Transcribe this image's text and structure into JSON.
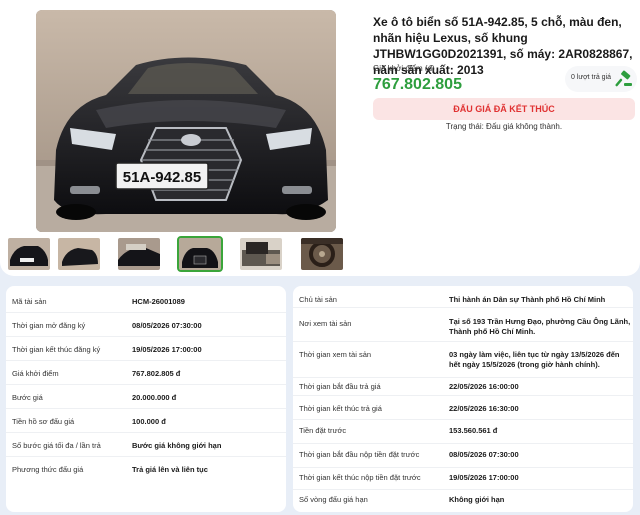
{
  "listing": {
    "title": "Xe ô tô biển số 51A-942.85, 5 chỗ, màu đen, nhãn hiệu Lexus, số khung JTHBW1GG0D2021391, số máy: 2AR0828867, năm sản xuất: 2013",
    "price_label": "Giá khởi điểm (đ)",
    "price": "767.802.805",
    "bid_count": "0 lượt trả giá",
    "status_button": "ĐẤU GIÁ ĐÃ KẾT THÚC",
    "status_text": "Trạng thái: Đấu giá không thành.",
    "plate": "51A-942.85"
  },
  "gallery": {
    "thumbs": [
      "thumb-1",
      "thumb-2",
      "thumb-3",
      "thumb-4",
      "thumb-5",
      "thumb-6"
    ],
    "active_index": 3
  },
  "left_details": [
    {
      "k": "Mã tài sản",
      "v": "HCM-26001089"
    },
    {
      "k": "Thời gian mở đăng ký",
      "v": "08/05/2026 07:30:00"
    },
    {
      "k": "Thời gian kết thúc đăng ký",
      "v": "19/05/2026 17:00:00"
    },
    {
      "k": "Giá khởi điểm",
      "v": "767.802.805 đ"
    },
    {
      "k": "Bước giá",
      "v": "20.000.000 đ"
    },
    {
      "k": "Tiền hồ sơ đấu giá",
      "v": "100.000 đ"
    },
    {
      "k": "Số bước giá tối đa / lần trả",
      "v": "Bước giá không giới hạn"
    },
    {
      "k": "Phương thức đấu giá",
      "v": "Trả giá lên và liên tục"
    }
  ],
  "right_details": [
    {
      "k": "Chủ tài sản",
      "v": "Thi hành án Dân sự Thành phố Hồ Chí Minh"
    },
    {
      "k": "Nơi xem tài sản",
      "v": "Tại số 193 Trần Hưng Đạo, phường Cầu Ông Lãnh, Thành phố Hồ Chí Minh."
    },
    {
      "k": "Thời gian xem tài sản",
      "v": "03 ngày làm việc, liên tục từ ngày 13/5/2026 đến hết ngày 15/5/2026 (trong giờ hành chính)."
    },
    {
      "k": "Thời gian bắt đầu trả giá",
      "v": "22/05/2026 16:00:00"
    },
    {
      "k": "Thời gian kết thúc trả giá",
      "v": "22/05/2026 16:30:00"
    },
    {
      "k": "Tiền đặt trước",
      "v": "153.560.561 đ"
    },
    {
      "k": "Thời gian bắt đầu nộp tiền đặt trước",
      "v": "08/05/2026 07:30:00"
    },
    {
      "k": "Thời gian kết thúc nộp tiền đặt trước",
      "v": "19/05/2026 17:00:00"
    },
    {
      "k": "Số vòng đấu giá hạn",
      "v": "Không giới hạn"
    }
  ],
  "colors": {
    "accent_green": "#2e9e3e",
    "ended_red": "#e03232",
    "ended_bg": "#fbe4e4"
  }
}
